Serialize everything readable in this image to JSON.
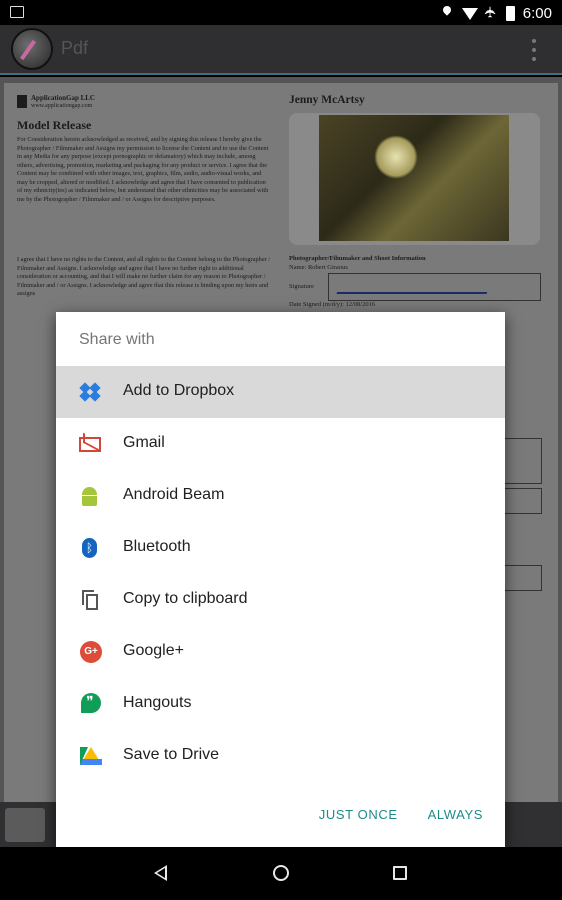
{
  "status_bar": {
    "time": "6:00"
  },
  "app_bar": {
    "title": "Pdf"
  },
  "document": {
    "company_name": "ApplicationGap LLC",
    "company_url": "www.applicationgap.com",
    "heading": "Model Release",
    "para1": "For Consideration herein acknowledged as received, and by signing this release I hereby give the Photographer / Filmmaker and Assigns my permission to license the Content and to use the Content in any Media for any purpose (except pornographic or defamatory) which may include, among others, advertising, promotion, marketing and packaging for any product or service. I agree that the Content may be combined with other images, text, graphics, film, audio, audio-visual works, and may be cropped, altered or modified. I acknowledge and agree that I have consented to publication of my ethnicity(ies) as indicated below, but understand that other ethnicities may be associated with me by the Photographer / Filmmaker and / or Assigns for descriptive purposes.",
    "para2": "I agree that I have no rights to the Content, and all rights to the Content belong to the Photographer / Filmmaker and Assigns. I acknowledge and agree that I have no further right to additional consideration or accounting, and that I will make no further claim for any reason to Photographer / Filmmaker and / or Assigns. I acknowledge and agree that this release is binding upon my heirs and assigns",
    "model_name": "Jenny McArtsy",
    "section_title": "Photographer/Filmmaker and Shoot Information",
    "name_line": "Name: Robert Giraous",
    "signature_label": "Signature",
    "date_line": "Date Signed (m/d/y): 12/08/2016"
  },
  "share_dialog": {
    "title": "Share with",
    "items": [
      {
        "label": "Add to Dropbox",
        "icon": "dropbox-icon",
        "selected": true
      },
      {
        "label": "Gmail",
        "icon": "gmail-icon"
      },
      {
        "label": "Android Beam",
        "icon": "android-beam-icon"
      },
      {
        "label": "Bluetooth",
        "icon": "bluetooth-icon"
      },
      {
        "label": "Copy to clipboard",
        "icon": "clipboard-icon"
      },
      {
        "label": "Google+",
        "icon": "google-plus-icon"
      },
      {
        "label": "Hangouts",
        "icon": "hangouts-icon"
      },
      {
        "label": "Save to Drive",
        "icon": "drive-icon"
      }
    ],
    "just_once_label": "JUST ONCE",
    "always_label": "ALWAYS",
    "accent_color": "#1d8b8b"
  }
}
